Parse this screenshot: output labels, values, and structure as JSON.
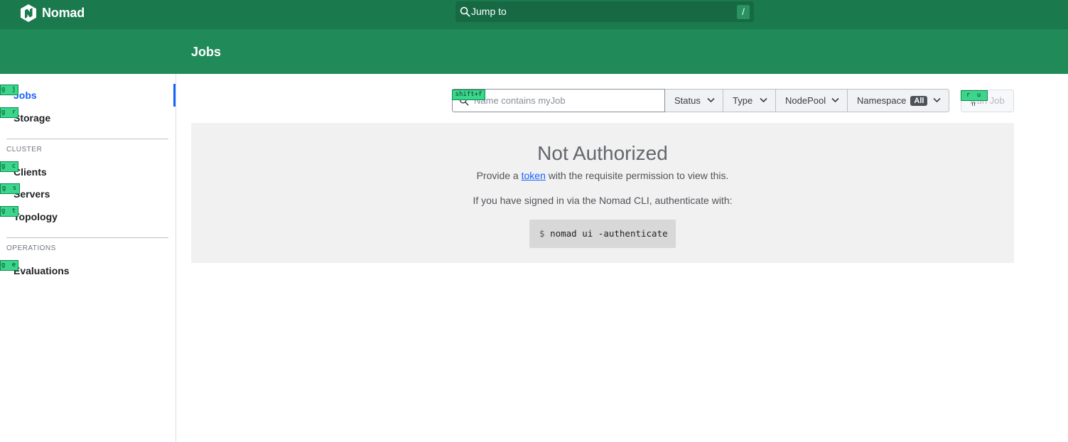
{
  "topbar": {
    "brand_name": "Nomad",
    "jump_placeholder": "Jump to",
    "jump_shortcut": "/"
  },
  "page_title": "Jobs",
  "sidebar": {
    "items_top": [
      {
        "label": "Jobs",
        "hint": "g j",
        "active": true
      },
      {
        "label": "Storage",
        "hint": "g r"
      }
    ],
    "cluster_label": "CLUSTER",
    "cluster_items": [
      {
        "label": "Clients",
        "hint": "g c"
      },
      {
        "label": "Servers",
        "hint": "g s"
      },
      {
        "label": "Topology",
        "hint": "g t"
      }
    ],
    "operations_label": "OPERATIONS",
    "operations_items": [
      {
        "label": "Evaluations",
        "hint": "g e"
      }
    ]
  },
  "toolbar": {
    "search_placeholder": "Name contains myJob",
    "search_hint": "shift+f",
    "filters": [
      "Status",
      "Type",
      "NodePool",
      "Namespace"
    ],
    "namespace_badge": "All",
    "run_label": "Run Job",
    "run_hint": "r u n"
  },
  "not_authorized": {
    "title": "Not Authorized",
    "line1_pre": "Provide a ",
    "line1_link": "token",
    "line1_post": " with the requisite permission to view this.",
    "line2": "If you have signed in via the Nomad CLI, authenticate with:",
    "code_prompt": "$",
    "code_command": "nomad ui -authenticate"
  },
  "colors": {
    "topbar": "#1a7a4e",
    "header": "#208a59",
    "active": "#1563ff",
    "hint_bg": "#3bd68c"
  },
  "icons": {
    "brand": "nomad-logo-icon",
    "jump": "search-icon",
    "search": "search-icon",
    "filter": "chevron-down-icon"
  }
}
